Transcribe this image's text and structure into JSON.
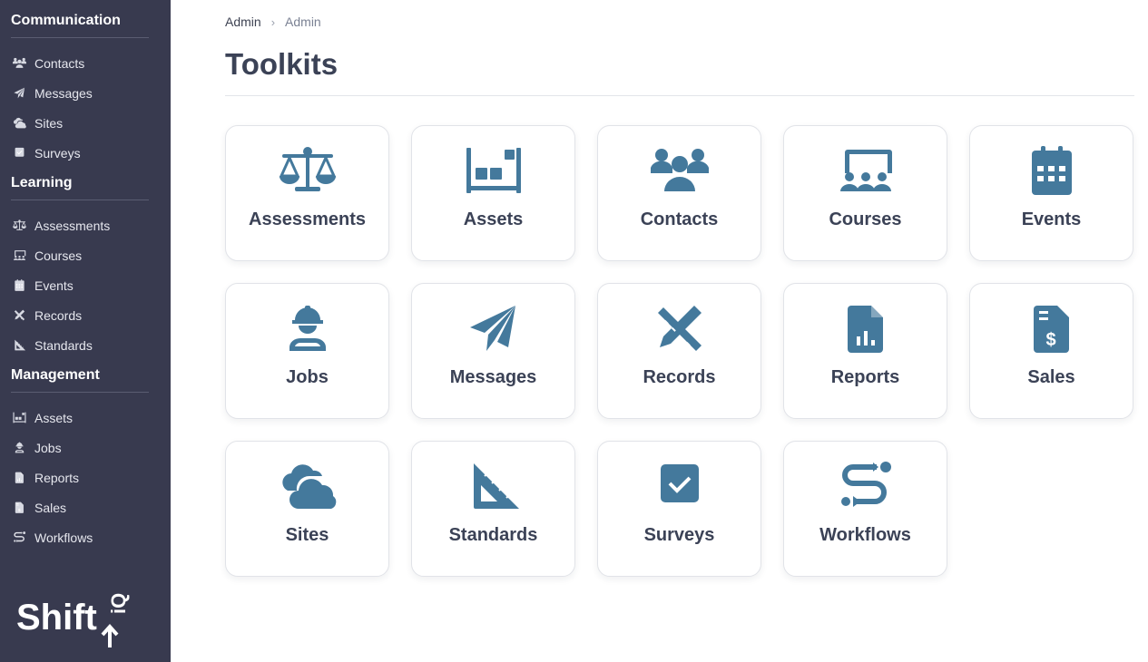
{
  "sidebar": {
    "sections": [
      {
        "title": "Communication",
        "items": [
          {
            "label": "Contacts",
            "icon": "users-icon"
          },
          {
            "label": "Messages",
            "icon": "paper-plane-icon"
          },
          {
            "label": "Sites",
            "icon": "cloud-icon"
          },
          {
            "label": "Surveys",
            "icon": "check-square-icon"
          }
        ]
      },
      {
        "title": "Learning",
        "items": [
          {
            "label": "Assessments",
            "icon": "scale-icon"
          },
          {
            "label": "Courses",
            "icon": "chalkboard-icon"
          },
          {
            "label": "Events",
            "icon": "calendar-icon"
          },
          {
            "label": "Records",
            "icon": "pencil-ruler-icon"
          },
          {
            "label": "Standards",
            "icon": "triangle-ruler-icon"
          }
        ]
      },
      {
        "title": "Management",
        "items": [
          {
            "label": "Assets",
            "icon": "shelf-icon"
          },
          {
            "label": "Jobs",
            "icon": "worker-icon"
          },
          {
            "label": "Reports",
            "icon": "report-file-icon"
          },
          {
            "label": "Sales",
            "icon": "invoice-dollar-icon"
          },
          {
            "label": "Workflows",
            "icon": "route-icon"
          }
        ]
      }
    ]
  },
  "logo": {
    "text": "Shift",
    "suffix": "iQ"
  },
  "breadcrumb": {
    "root": "Admin",
    "current": "Admin"
  },
  "page": {
    "title": "Toolkits"
  },
  "colors": {
    "sidebar_bg": "#383a4f",
    "icon_accent": "#44799c",
    "title": "#3b4256"
  },
  "toolkits": [
    {
      "label": "Assessments",
      "icon": "scale-icon"
    },
    {
      "label": "Assets",
      "icon": "shelf-icon"
    },
    {
      "label": "Contacts",
      "icon": "users-icon"
    },
    {
      "label": "Courses",
      "icon": "chalkboard-icon"
    },
    {
      "label": "Events",
      "icon": "calendar-icon"
    },
    {
      "label": "Jobs",
      "icon": "worker-icon"
    },
    {
      "label": "Messages",
      "icon": "paper-plane-icon"
    },
    {
      "label": "Records",
      "icon": "pencil-ruler-icon"
    },
    {
      "label": "Reports",
      "icon": "report-file-icon"
    },
    {
      "label": "Sales",
      "icon": "invoice-dollar-icon"
    },
    {
      "label": "Sites",
      "icon": "cloud-icon"
    },
    {
      "label": "Standards",
      "icon": "triangle-ruler-icon"
    },
    {
      "label": "Surveys",
      "icon": "check-square-icon"
    },
    {
      "label": "Workflows",
      "icon": "route-icon"
    }
  ]
}
